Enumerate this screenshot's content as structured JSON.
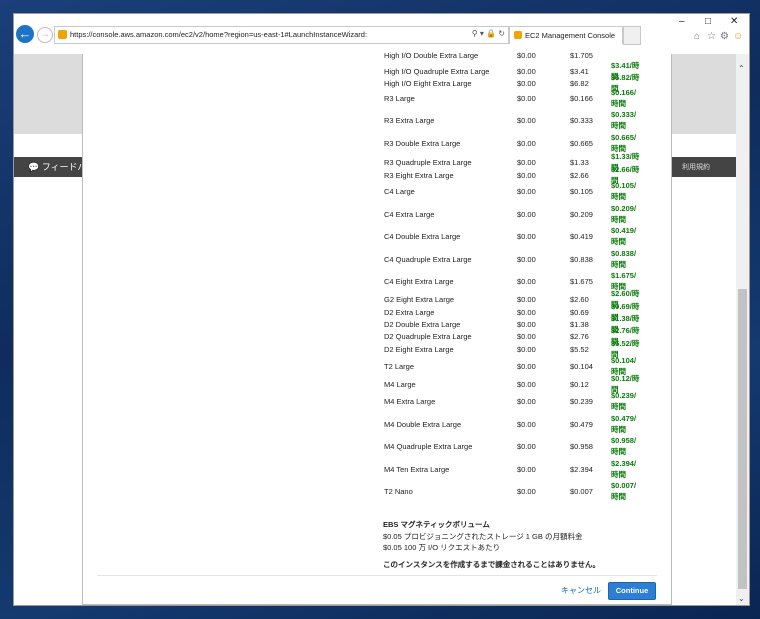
{
  "browser": {
    "url": "https://console.aws.amazon.com/ec2/v2/home?region=us-east-1#LaunchInstanceWizard:",
    "tab_title": "EC2 Management Console"
  },
  "page": {
    "feedback_label": "フィードバ",
    "terms_label": "利用規約"
  },
  "pricing_rows": [
    {
      "name": "High I/O Double Extra Large",
      "col1": "$0.00",
      "col2": "$1.705",
      "col3": ""
    },
    {
      "name": "High I/O Quadruple Extra Large",
      "col1": "$0.00",
      "col2": "$3.41",
      "col3": "$3.41/時間"
    },
    {
      "name": "High I/O Eight Extra Large",
      "col1": "$0.00",
      "col2": "$6.82",
      "col3": "$6.82/時間"
    },
    {
      "name": "R3 Large",
      "col1": "$0.00",
      "col2": "$0.166",
      "col3": "$0.166/時間"
    },
    {
      "name": "R3 Extra Large",
      "col1": "$0.00",
      "col2": "$0.333",
      "col3": "$0.333/時間"
    },
    {
      "name": "R3 Double Extra Large",
      "col1": "$0.00",
      "col2": "$0.665",
      "col3": "$0.665/時間"
    },
    {
      "name": "R3 Quadruple Extra Large",
      "col1": "$0.00",
      "col2": "$1.33",
      "col3": "$1.33/時間"
    },
    {
      "name": "R3 Eight Extra Large",
      "col1": "$0.00",
      "col2": "$2.66",
      "col3": "$2.66/時間"
    },
    {
      "name": "C4 Large",
      "col1": "$0.00",
      "col2": "$0.105",
      "col3": "$0.105/時間"
    },
    {
      "name": "C4 Extra Large",
      "col1": "$0.00",
      "col2": "$0.209",
      "col3": "$0.209/時間"
    },
    {
      "name": "C4 Double Extra Large",
      "col1": "$0.00",
      "col2": "$0.419",
      "col3": "$0.419/時間"
    },
    {
      "name": "C4 Quadruple Extra Large",
      "col1": "$0.00",
      "col2": "$0.838",
      "col3": "$0.838/時間"
    },
    {
      "name": "C4 Eight Extra Large",
      "col1": "$0.00",
      "col2": "$1.675",
      "col3": "$1.675/時間"
    },
    {
      "name": "G2 Eight Extra Large",
      "col1": "$0.00",
      "col2": "$2.60",
      "col3": "$2.60/時間"
    },
    {
      "name": "D2 Extra Large",
      "col1": "$0.00",
      "col2": "$0.69",
      "col3": "$0.69/時間"
    },
    {
      "name": "D2 Double Extra Large",
      "col1": "$0.00",
      "col2": "$1.38",
      "col3": "$1.38/時間"
    },
    {
      "name": "D2 Quadruple Extra Large",
      "col1": "$0.00",
      "col2": "$2.76",
      "col3": "$2.76/時間"
    },
    {
      "name": "D2 Eight Extra Large",
      "col1": "$0.00",
      "col2": "$5.52",
      "col3": "$5.52/時間"
    },
    {
      "name": "T2 Large",
      "col1": "$0.00",
      "col2": "$0.104",
      "col3": "$0.104/時間"
    },
    {
      "name": "M4 Large",
      "col1": "$0.00",
      "col2": "$0.12",
      "col3": "$0.12/時間"
    },
    {
      "name": "M4 Extra Large",
      "col1": "$0.00",
      "col2": "$0.239",
      "col3": "$0.239/時間"
    },
    {
      "name": "M4 Double Extra Large",
      "col1": "$0.00",
      "col2": "$0.479",
      "col3": "$0.479/時間"
    },
    {
      "name": "M4 Quadruple Extra Large",
      "col1": "$0.00",
      "col2": "$0.958",
      "col3": "$0.958/時間"
    },
    {
      "name": "M4 Ten Extra Large",
      "col1": "$0.00",
      "col2": "$2.394",
      "col3": "$2.394/時間"
    },
    {
      "name": "T2 Nano",
      "col1": "$0.00",
      "col2": "$0.007",
      "col3": "$0.007/時間"
    }
  ],
  "ebs": {
    "title": "EBS マグネティックボリューム",
    "line1": "$0.05 プロビジョニングされたストレージ 1 GB の月額料金",
    "line2": "$0.05 100 万 I/O リクエストあたり",
    "note": "このインスタンスを作成するまで課金されることはありません。"
  },
  "buttons": {
    "cancel": "キャンセル",
    "continue": "Continue"
  },
  "colors": {
    "accent": "#2d7fd6",
    "price_green": "#0a7a0a",
    "link_blue": "#0a64b5"
  }
}
